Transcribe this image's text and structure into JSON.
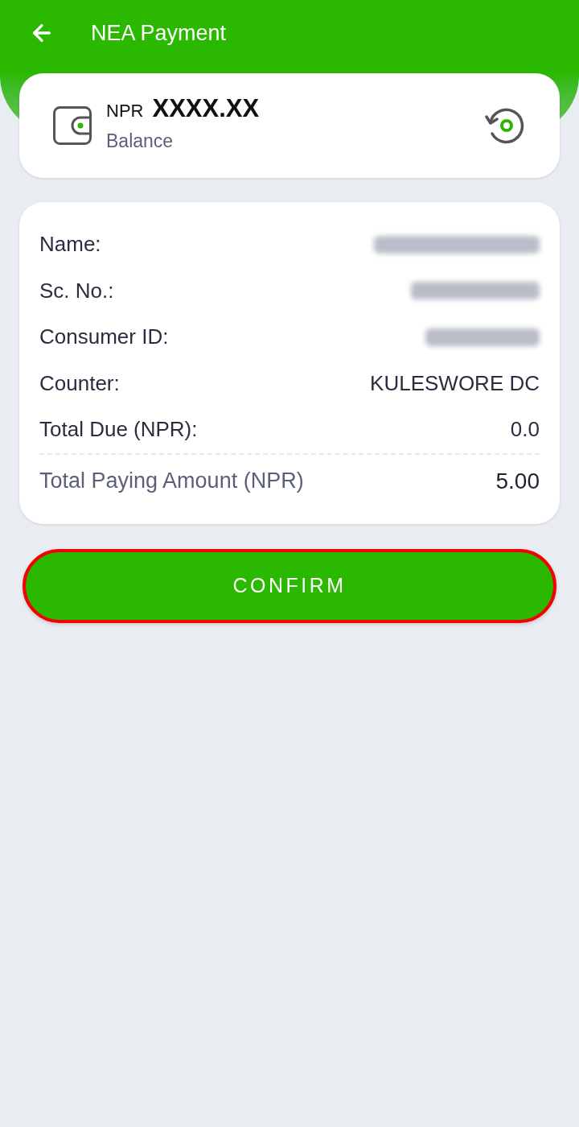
{
  "header": {
    "title": "NEA Payment"
  },
  "balance": {
    "currency": "NPR",
    "amount": "XXXX.XX",
    "label": "Balance"
  },
  "details": {
    "rows": [
      {
        "label": "Name:",
        "blurred": true
      },
      {
        "label": "Sc. No.:",
        "blurred": true
      },
      {
        "label": "Consumer ID:",
        "blurred": true
      },
      {
        "label": "Counter:",
        "blurred": false,
        "value": "KULESWORE DC"
      },
      {
        "label": "Total Due (NPR):",
        "blurred": false,
        "value": "0.0"
      }
    ],
    "total": {
      "label": "Total Paying Amount (NPR)",
      "value": "5.00"
    }
  },
  "confirm_button": {
    "label": "CONFIRM",
    "highlighted": true
  }
}
